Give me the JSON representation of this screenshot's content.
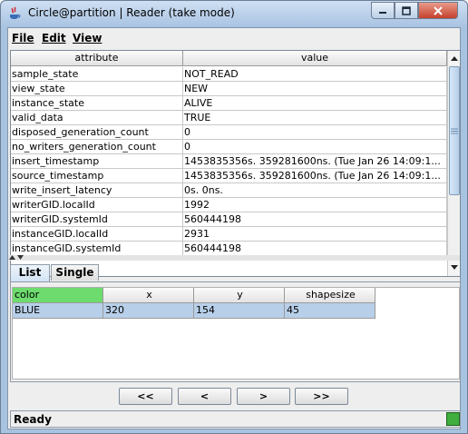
{
  "window": {
    "title": "Circle@partition | Reader (take mode)"
  },
  "menu": {
    "file": "File",
    "edit": "Edit",
    "view": "View"
  },
  "attributes": {
    "headers": [
      "attribute",
      "value"
    ],
    "rows": [
      [
        "sample_state",
        "NOT_READ"
      ],
      [
        "view_state",
        "NEW"
      ],
      [
        "instance_state",
        "ALIVE"
      ],
      [
        "valid_data",
        "TRUE"
      ],
      [
        "disposed_generation_count",
        "0"
      ],
      [
        "no_writers_generation_count",
        "0"
      ],
      [
        "insert_timestamp",
        "1453835356s. 359281600ns. (Tue Jan 26 14:09:1..."
      ],
      [
        "source_timestamp",
        "1453835356s. 359281600ns. (Tue Jan 26 14:09:1..."
      ],
      [
        "write_insert_latency",
        "0s. 0ns."
      ],
      [
        "writerGID.localId",
        "1992"
      ],
      [
        "writerGID.systemId",
        "560444198"
      ],
      [
        "instanceGID.localId",
        "2931"
      ],
      [
        "instanceGID.systemId",
        "560444198"
      ]
    ]
  },
  "tabs": {
    "list": "List",
    "single": "Single"
  },
  "samples": {
    "headers": [
      "color",
      "x",
      "y",
      "shapesize"
    ],
    "rows": [
      [
        "BLUE",
        "320",
        "154",
        "45"
      ]
    ]
  },
  "navigation": {
    "first": "<<",
    "prev": "<",
    "next": ">",
    "last": ">>"
  },
  "status": {
    "text": "Ready",
    "indicator_color": "#3fae3f"
  }
}
